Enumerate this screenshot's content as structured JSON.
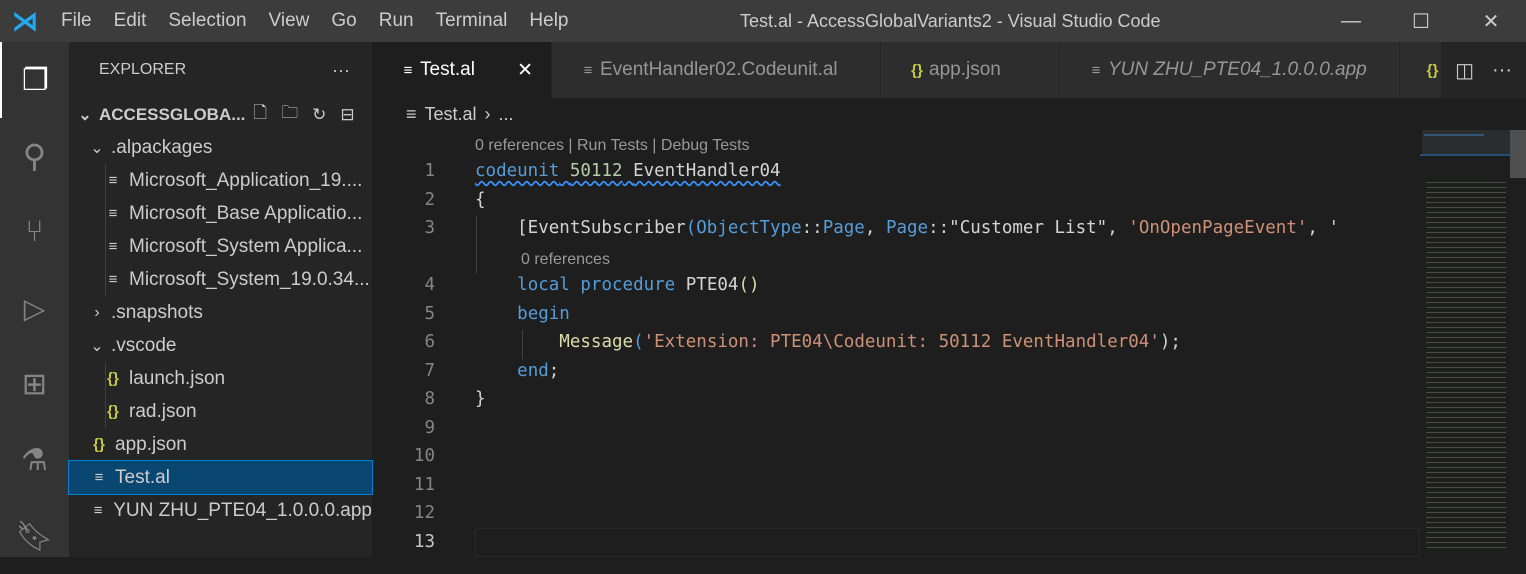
{
  "titlebar": {
    "menu": [
      "File",
      "Edit",
      "Selection",
      "View",
      "Go",
      "Run",
      "Terminal",
      "Help"
    ],
    "title": "Test.al - AccessGlobalVariants2 - Visual Studio Code"
  },
  "activity_bar": [
    "explorer-icon",
    "search-icon",
    "source-control-icon",
    "run-debug-icon",
    "extensions-icon",
    "testing-icon",
    "bookmarks-icon"
  ],
  "sidebar": {
    "title": "EXPLORER",
    "more": "···",
    "root": "ACCESSGLOBA...",
    "items": [
      {
        "label": ".alpackages",
        "type": "folder",
        "expanded": true,
        "depth": 1
      },
      {
        "label": "Microsoft_Application_19....",
        "type": "file",
        "depth": 2
      },
      {
        "label": "Microsoft_Base Applicatio...",
        "type": "file",
        "depth": 2
      },
      {
        "label": "Microsoft_System Applica...",
        "type": "file",
        "depth": 2
      },
      {
        "label": "Microsoft_System_19.0.34...",
        "type": "file",
        "depth": 2
      },
      {
        "label": ".snapshots",
        "type": "folder",
        "expanded": false,
        "depth": 1
      },
      {
        "label": ".vscode",
        "type": "folder",
        "expanded": true,
        "depth": 1
      },
      {
        "label": "launch.json",
        "type": "json",
        "depth": 2
      },
      {
        "label": "rad.json",
        "type": "json",
        "depth": 2
      },
      {
        "label": "app.json",
        "type": "json",
        "depth": 1
      },
      {
        "label": "Test.al",
        "type": "file",
        "depth": 1,
        "selected": true
      },
      {
        "label": "YUN ZHU_PTE04_1.0.0.0.app",
        "type": "file",
        "depth": 1
      }
    ]
  },
  "tabs": [
    {
      "label": "Test.al",
      "active": true,
      "close": "✕"
    },
    {
      "label": "EventHandler02.Codeunit.al"
    },
    {
      "label": "app.json",
      "json": true
    },
    {
      "label": "YUN ZHU_PTE04_1.0.0.0.app",
      "italic": true
    }
  ],
  "breadcrumb": {
    "file": "Test.al",
    "sep": "›",
    "rest": "..."
  },
  "editor": {
    "lens1": "0 references | Run Tests | Debug Tests",
    "lens2": "0 references",
    "line_numbers": [
      "1",
      "2",
      "3",
      "4",
      "5",
      "6",
      "7",
      "8",
      "9",
      "10",
      "11",
      "12",
      "13"
    ],
    "l1": {
      "kw": "codeunit",
      "num": "50112",
      "name": "EventHandler04"
    },
    "l2": "{",
    "l3": {
      "a": "    [EventSubscriber",
      "b": "(",
      "c": "ObjectType",
      "d": "::",
      "e": "Page",
      ",": ", ",
      "f": "Page",
      "g": "::\"Customer List\", ",
      "h": "'OnOpenPageEvent'",
      "i": ", '"
    },
    "l4": {
      "kw1": "local",
      "kw2": "procedure",
      "name": "PTE04",
      "paren": "()"
    },
    "l5": "begin",
    "l6": {
      "fn": "Message",
      "p1": "(",
      "str": "'Extension: PTE04\\Codeunit: 50112 EventHandler04'",
      "p2": ");"
    },
    "l7": {
      "kw": "end",
      "semi": ";"
    },
    "l8": "}"
  }
}
